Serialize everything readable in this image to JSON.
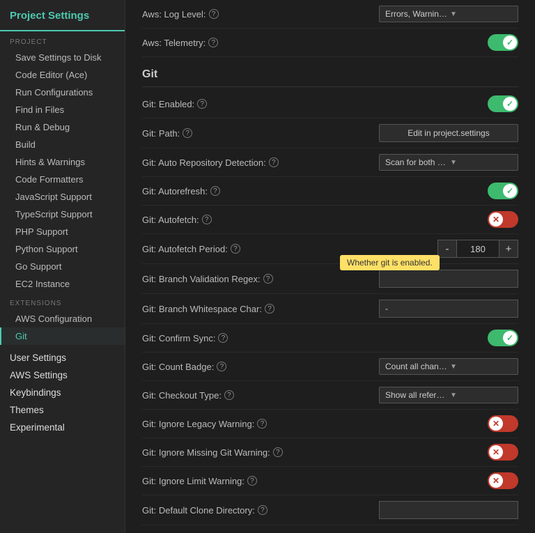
{
  "sidebar": {
    "title": "Project Settings",
    "project_section": "PROJECT",
    "items_project": [
      {
        "label": "Save Settings to Disk",
        "active": false
      },
      {
        "label": "Code Editor (Ace)",
        "active": false
      },
      {
        "label": "Run Configurations",
        "active": false
      },
      {
        "label": "Find in Files",
        "active": false
      },
      {
        "label": "Run & Debug",
        "active": false
      },
      {
        "label": "Build",
        "active": false
      },
      {
        "label": "Hints & Warnings",
        "active": false
      },
      {
        "label": "Code Formatters",
        "active": false
      },
      {
        "label": "JavaScript Support",
        "active": false
      },
      {
        "label": "TypeScript Support",
        "active": false
      },
      {
        "label": "PHP Support",
        "active": false
      },
      {
        "label": "Python Support",
        "active": false
      },
      {
        "label": "Go Support",
        "active": false
      },
      {
        "label": "EC2 Instance",
        "active": false
      }
    ],
    "extensions_section": "EXTENSIONS",
    "items_extensions": [
      {
        "label": "AWS Configuration",
        "active": false
      },
      {
        "label": "Git",
        "active": true
      }
    ],
    "items_bottom": [
      {
        "label": "User Settings",
        "active": false
      },
      {
        "label": "AWS Settings",
        "active": false
      },
      {
        "label": "Keybindings",
        "active": false
      },
      {
        "label": "Themes",
        "active": false
      },
      {
        "label": "Experimental",
        "active": false
      }
    ]
  },
  "content": {
    "aws_log_level_label": "Aws: Log Level:",
    "aws_log_level_value": "Errors, Warnings, and Info",
    "aws_telemetry_label": "Aws: Telemetry:",
    "aws_telemetry_on": true,
    "git_section": "Git",
    "settings": [
      {
        "label": "Git: Enabled:",
        "has_tooltip": true,
        "control": "toggle-on"
      },
      {
        "label": "Git: Path:",
        "has_tooltip": true,
        "control": "button",
        "button_text": "Edit in project.settings"
      },
      {
        "label": "Git: Auto Repository Detection:",
        "has_tooltip": true,
        "control": "dropdown",
        "value": "Scan for both subfolders of th"
      },
      {
        "label": "Git: Autorefresh:",
        "has_tooltip": true,
        "control": "toggle-on"
      },
      {
        "label": "Git: Autofetch:",
        "has_tooltip": true,
        "control": "toggle-off"
      },
      {
        "label": "Git: Autofetch Period:",
        "has_tooltip": true,
        "control": "stepper",
        "value": "180"
      },
      {
        "label": "Git: Branch Validation Regex:",
        "has_tooltip": true,
        "control": "text",
        "value": ""
      },
      {
        "label": "Git: Branch Whitespace Char:",
        "has_tooltip": true,
        "control": "text",
        "value": "-"
      },
      {
        "label": "Git: Confirm Sync:",
        "has_tooltip": true,
        "control": "toggle-on"
      },
      {
        "label": "Git: Count Badge:",
        "has_tooltip": true,
        "control": "dropdown",
        "value": "Count all changes."
      },
      {
        "label": "Git: Checkout Type:",
        "has_tooltip": true,
        "control": "dropdown",
        "value": "Show all references."
      },
      {
        "label": "Git: Ignore Legacy Warning:",
        "has_tooltip": true,
        "control": "toggle-off"
      },
      {
        "label": "Git: Ignore Missing Git Warning:",
        "has_tooltip": true,
        "control": "toggle-off"
      },
      {
        "label": "Git: Ignore Limit Warning:",
        "has_tooltip": true,
        "control": "toggle-off"
      },
      {
        "label": "Git: Default Clone Directory:",
        "has_tooltip": true,
        "control": "text",
        "value": ""
      }
    ],
    "tooltip_text": "Whether git is enabled.",
    "stepper_minus": "-",
    "stepper_plus": "+"
  }
}
